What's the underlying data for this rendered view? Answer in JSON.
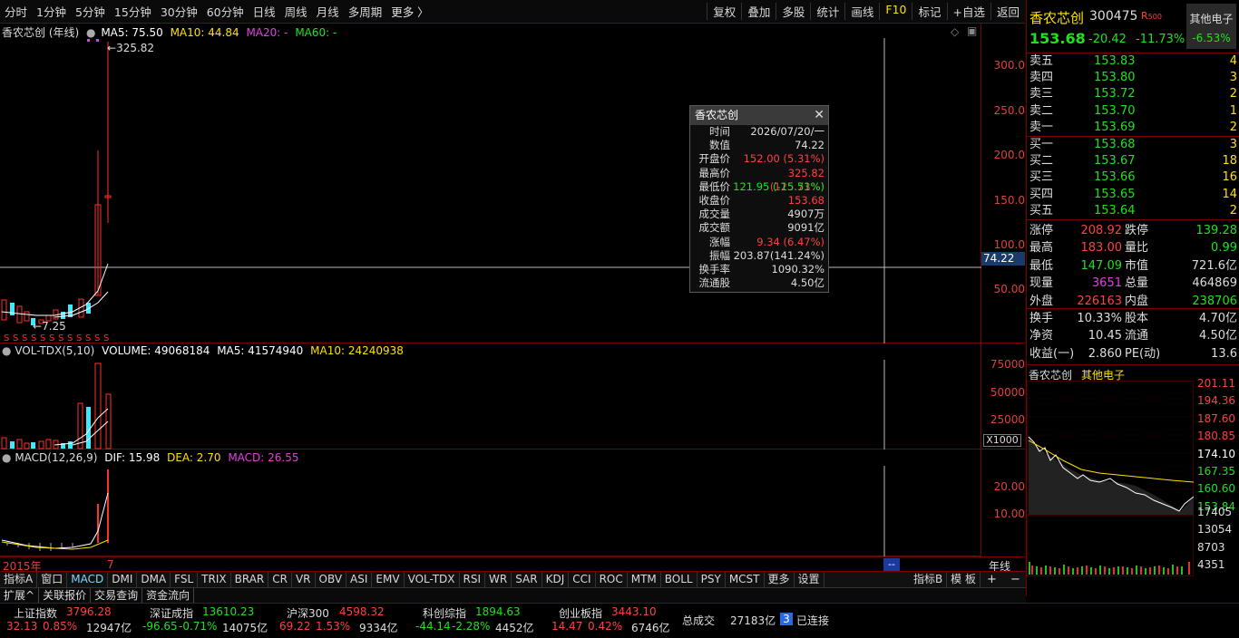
{
  "toolbar": {
    "periods": [
      "分时",
      "1分钟",
      "5分钟",
      "15分钟",
      "30分钟",
      "60分钟",
      "日线",
      "周线",
      "月线",
      "多周期"
    ],
    "more": "更多 〉",
    "actions": [
      "复权",
      "叠加",
      "多股",
      "统计",
      "画线",
      "F10",
      "标记",
      "+自选",
      "返回"
    ]
  },
  "kline": {
    "stock_label": "香农芯创 (年线)",
    "ma5": "MA5: 75.50",
    "ma10": "MA10: 44.84",
    "ma20": "MA20: -",
    "ma60": "MA60: -",
    "high_mark": "325.82",
    "low_mark": "7.25",
    "cursor_price": "74.22",
    "axis": [
      "300.0",
      "250.0",
      "200.0",
      "150.0",
      "100.0",
      "50.00"
    ],
    "year_label": "2015年",
    "x_tick": "7",
    "period_label": "年线",
    "cursor_time": "--"
  },
  "volume": {
    "label": "VOL-TDX(5,10)",
    "volume": "VOLUME: 49068184",
    "ma5": "MA5: 41574940",
    "ma10": "MA10: 24240938",
    "axis": [
      "75000",
      "50000",
      "25000"
    ],
    "unit": "X1000"
  },
  "macd": {
    "label": "MACD(12,26,9)",
    "dif": "DIF: 15.98",
    "dea": "DEA: 2.70",
    "macd": "MACD: 26.55",
    "axis": [
      "20.00",
      "10.00"
    ]
  },
  "tooltip": {
    "title": "香农芯创",
    "close": "✕",
    "rows": [
      {
        "k": "时间",
        "v": "2026/07/20/一",
        "c": "#dddddd"
      },
      {
        "k": "数值",
        "v": "74.22",
        "c": "#dddddd"
      },
      {
        "k": "开盘价",
        "v": "152.00 (5.31%)",
        "c": "#ff4040"
      },
      {
        "k": "最高价",
        "v": "325.82 (125.73%)",
        "c": "#ff4040"
      },
      {
        "k": "最低价",
        "v": "121.95 (-15.51%)",
        "c": "#20e020"
      },
      {
        "k": "收盘价",
        "v": "153.68",
        "c": "#ff4040"
      },
      {
        "k": "成交量",
        "v": "4907万",
        "c": "#dddddd"
      },
      {
        "k": "成交额",
        "v": "9091亿",
        "c": "#dddddd"
      },
      {
        "k": "涨幅",
        "v": "9.34 (6.47%)",
        "c": "#ff4040"
      },
      {
        "k": "振幅",
        "v": "203.87(141.24%)",
        "c": "#dddddd"
      },
      {
        "k": "换手率",
        "v": "1090.32%",
        "c": "#dddddd"
      },
      {
        "k": "流通股",
        "v": "4.50亿",
        "c": "#dddddd"
      }
    ]
  },
  "quote": {
    "name": "香农芯创",
    "code": "300475",
    "badge": "R",
    "badge_sub": "500",
    "sector": "其他电子",
    "sector_pct": "-6.53%",
    "price": "153.68",
    "change": "-20.42",
    "change_pct": "-11.73%",
    "asks": [
      {
        "label": "卖五",
        "price": "153.83",
        "vol": "4"
      },
      {
        "label": "卖四",
        "price": "153.80",
        "vol": "3"
      },
      {
        "label": "卖三",
        "price": "153.72",
        "vol": "2"
      },
      {
        "label": "卖二",
        "price": "153.70",
        "vol": "1"
      },
      {
        "label": "卖一",
        "price": "153.69",
        "vol": "2"
      }
    ],
    "bids": [
      {
        "label": "买一",
        "price": "153.68",
        "vol": "3"
      },
      {
        "label": "买二",
        "price": "153.67",
        "vol": "18"
      },
      {
        "label": "买三",
        "price": "153.66",
        "vol": "16"
      },
      {
        "label": "买四",
        "price": "153.65",
        "vol": "14"
      },
      {
        "label": "买五",
        "price": "153.64",
        "vol": "2"
      }
    ],
    "stats": [
      {
        "k1": "涨停",
        "v1": "208.92",
        "c1": "#ff4040",
        "k2": "跌停",
        "v2": "139.28",
        "c2": "#20e020"
      },
      {
        "k1": "最高",
        "v1": "183.00",
        "c1": "#ff4040",
        "k2": "量比",
        "v2": "0.99",
        "c2": "#20e020"
      },
      {
        "k1": "最低",
        "v1": "147.09",
        "c1": "#20e020",
        "k2": "市值",
        "v2": "721.6亿",
        "c2": "#dddddd"
      },
      {
        "k1": "现量",
        "v1": "3651",
        "c1": "#e040e0",
        "k2": "总量",
        "v2": "464869",
        "c2": "#dddddd"
      },
      {
        "k1": "外盘",
        "v1": "226163",
        "c1": "#ff4040",
        "k2": "内盘",
        "v2": "238706",
        "c2": "#20e020"
      }
    ],
    "fund": [
      {
        "k1": "换手",
        "v1": "10.33%",
        "k2": "股本",
        "v2": "4.70亿"
      },
      {
        "k1": "净资",
        "v1": "10.45",
        "k2": "流通",
        "v2": "4.50亿"
      },
      {
        "k1": "收益(一)",
        "v1": "2.860",
        "k2": "PE(动)",
        "v2": "13.6"
      }
    ]
  },
  "mini_chart": {
    "name": "香农芯创",
    "sector": "其他电子",
    "axis": [
      "201.11",
      "194.36",
      "187.60",
      "180.85",
      "174.10",
      "167.35",
      "160.60",
      "153.84"
    ],
    "vol_axis": [
      "17405",
      "13054",
      "8703",
      "4351"
    ]
  },
  "indicator_tabs": [
    "指标A",
    "窗口",
    "MACD",
    "DMI",
    "DMA",
    "FSL",
    "TRIX",
    "BRAR",
    "CR",
    "VR",
    "OBV",
    "ASI",
    "EMV",
    "VOL-TDX",
    "RSI",
    "WR",
    "SAR",
    "KDJ",
    "CCI",
    "ROC",
    "MTM",
    "BOLL",
    "PSY",
    "MCST",
    "更多",
    "设置"
  ],
  "indicator_tabs_right": [
    "指标B",
    "模 板"
  ],
  "sub_tabs": [
    "扩展^",
    "关联报价",
    "交易查询",
    "资金流向"
  ],
  "indices": [
    {
      "name": "上证指数",
      "val": "3796.28",
      "chg": "32.13",
      "pct": "0.85%",
      "amt": "12947亿",
      "up": true
    },
    {
      "name": "深证成指",
      "val": "13610.23",
      "chg": "-96.65",
      "pct": "-0.71%",
      "amt": "14075亿",
      "up": false
    },
    {
      "name": "沪深300",
      "val": "4598.32",
      "chg": "69.22",
      "pct": "1.53%",
      "amt": "9334亿",
      "up": true
    },
    {
      "name": "科创综指",
      "val": "1894.63",
      "chg": "-44.14",
      "pct": "-2.28%",
      "amt": "4452亿",
      "up": false
    },
    {
      "name": "创业板指",
      "val": "3443.10",
      "chg": "14.47",
      "pct": "0.42%",
      "amt": "6746亿",
      "up": true
    }
  ],
  "total": {
    "label": "总成交",
    "val": "27183亿"
  },
  "connection": {
    "count": "3",
    "text": "已连接"
  },
  "icons": [
    "diamond-icon",
    "window-icon",
    "plus-icon",
    "minus-icon"
  ]
}
